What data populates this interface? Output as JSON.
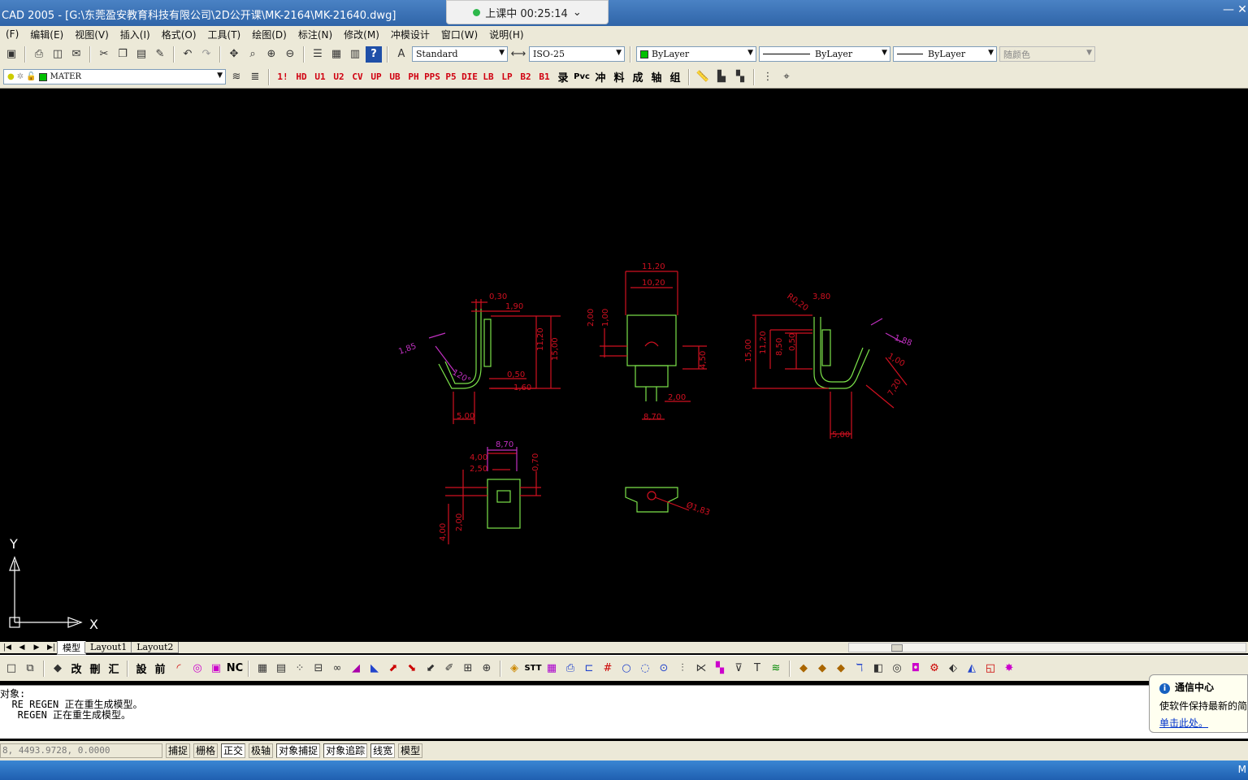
{
  "window": {
    "title": "CAD 2005 - [G:\\东莞盈安教育科技有限公司\\2D公开课\\MK-2164\\MK-21640.dwg]",
    "minimize": "—",
    "close": "✕"
  },
  "recording": {
    "label": "上课中 00:25:14",
    "chevron": "⌄"
  },
  "menu": [
    "(F)",
    "编辑(E)",
    "视图(V)",
    "插入(I)",
    "格式(O)",
    "工具(T)",
    "绘图(D)",
    "标注(N)",
    "修改(M)",
    "冲模设计",
    "窗口(W)",
    "说明(H)"
  ],
  "toolbar1": {
    "textstyle": "Standard",
    "dimstyle": "ISO-25",
    "color": "ByLayer",
    "linetype": "ByLayer",
    "lineweight": "ByLayer",
    "plotstyle": "随颜色"
  },
  "toolbar2": {
    "layer": "MATER",
    "custom_buttons": [
      "1!",
      "HD",
      "U1",
      "U2",
      "CV",
      "UP",
      "UB",
      "PH",
      "PPS",
      "P5",
      "DIE",
      "LB",
      "LP",
      "B2",
      "B1",
      "录",
      "Pvc",
      "冲",
      "料",
      "成",
      "轴",
      "组"
    ]
  },
  "toolbar3": {
    "custom_buttons": [
      "改",
      "刪",
      "汇",
      "設",
      "前",
      "NC",
      "STT"
    ]
  },
  "layout_tabs": [
    "模型",
    "Layout1",
    "Layout2"
  ],
  "ucs": {
    "x_label": "X",
    "y_label": "Y"
  },
  "drawing": {
    "side_left": {
      "dims": [
        "0,30",
        "1,90",
        "11,20",
        "15,00",
        "0,50",
        "1,60",
        "5,00",
        "1,85",
        "120°"
      ]
    },
    "front": {
      "dims": [
        "11,20",
        "10,20",
        "2,00",
        "1,00",
        "4,50",
        "2,00",
        "8,70"
      ]
    },
    "side_right": {
      "dims": [
        "3,80",
        "R0,20",
        "15,00",
        "11,20",
        "8,50",
        "0,50",
        "1,88",
        "1,00",
        "7,20",
        "5,00"
      ]
    },
    "bottom_left": {
      "dims": [
        "8,70",
        "4,00",
        "2,50",
        "0,70",
        "2,00",
        "4,00"
      ]
    },
    "bottom_mid": {
      "dims": [
        "Ø1,83"
      ]
    }
  },
  "command_lines": [
    "对象:",
    "  RE REGEN 正在重生成模型。",
    "   REGEN 正在重生成模型。"
  ],
  "notification": {
    "title": "通信中心",
    "body": "使软件保持最新的简",
    "link": "单击此处。"
  },
  "status": {
    "coords": "8, 4493.9728, 0.0000",
    "buttons": [
      "捕捉",
      "栅格",
      "正交",
      "极轴",
      "对象捕捉",
      "对象追踪",
      "线宽",
      "模型"
    ],
    "active": [
      2,
      4,
      5,
      6
    ]
  },
  "taskbar": {
    "label": "M"
  }
}
